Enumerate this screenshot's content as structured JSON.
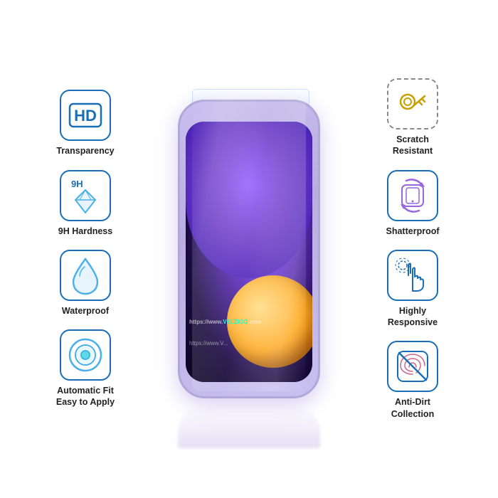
{
  "features": {
    "left": [
      {
        "id": "hd-transparency",
        "icon": "hd",
        "label": "Transparency"
      },
      {
        "id": "9h-hardness",
        "icon": "diamond",
        "label": "9H Hardness"
      },
      {
        "id": "waterproof",
        "icon": "drop",
        "label": "Waterproof"
      },
      {
        "id": "auto-fit",
        "icon": "circle-target",
        "label": "Automatic Fit\nEasy to Apply"
      }
    ],
    "right": [
      {
        "id": "scratch-resistant",
        "icon": "key",
        "label": "Scratch\nResistant"
      },
      {
        "id": "shatterproof",
        "icon": "rotate",
        "label": "Shatterproof"
      },
      {
        "id": "highly-responsive",
        "icon": "finger",
        "label": "Highly\nResponsive"
      },
      {
        "id": "anti-dirt",
        "icon": "fingerprint-no",
        "label": "Anti-Dirt\nCollection"
      }
    ]
  },
  "brand": {
    "watermark": "https://www.VELZIGO.com",
    "watermark2": "https://www.V..."
  }
}
